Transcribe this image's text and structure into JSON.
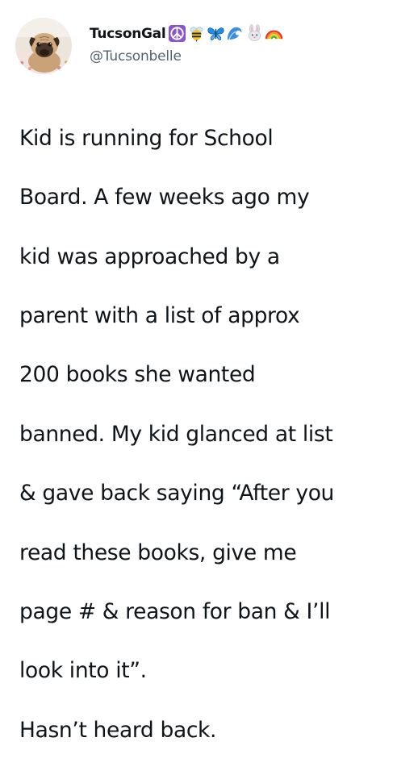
{
  "user": {
    "display_name": "TucsonGal",
    "name_emojis": [
      "peace-symbol",
      "bee",
      "butterfly",
      "water-wave",
      "rabbit-face",
      "rainbow"
    ],
    "handle": "@Tucsonbelle",
    "avatar": "pug-dog-photo"
  },
  "tweet": {
    "lines": [
      "Kid is running for School",
      "Board. A few weeks ago my",
      "kid was approached by a",
      "parent with a list of approx",
      "200 books she wanted",
      "banned. My kid glanced at list",
      "& gave back saying “After you",
      "read these books, give me",
      "page # & reason for ban & I’ll",
      "look into it”.",
      "Hasn’t heard back."
    ]
  },
  "colors": {
    "text": "#0f1419",
    "secondary_text": "#536471",
    "background": "#ffffff"
  }
}
